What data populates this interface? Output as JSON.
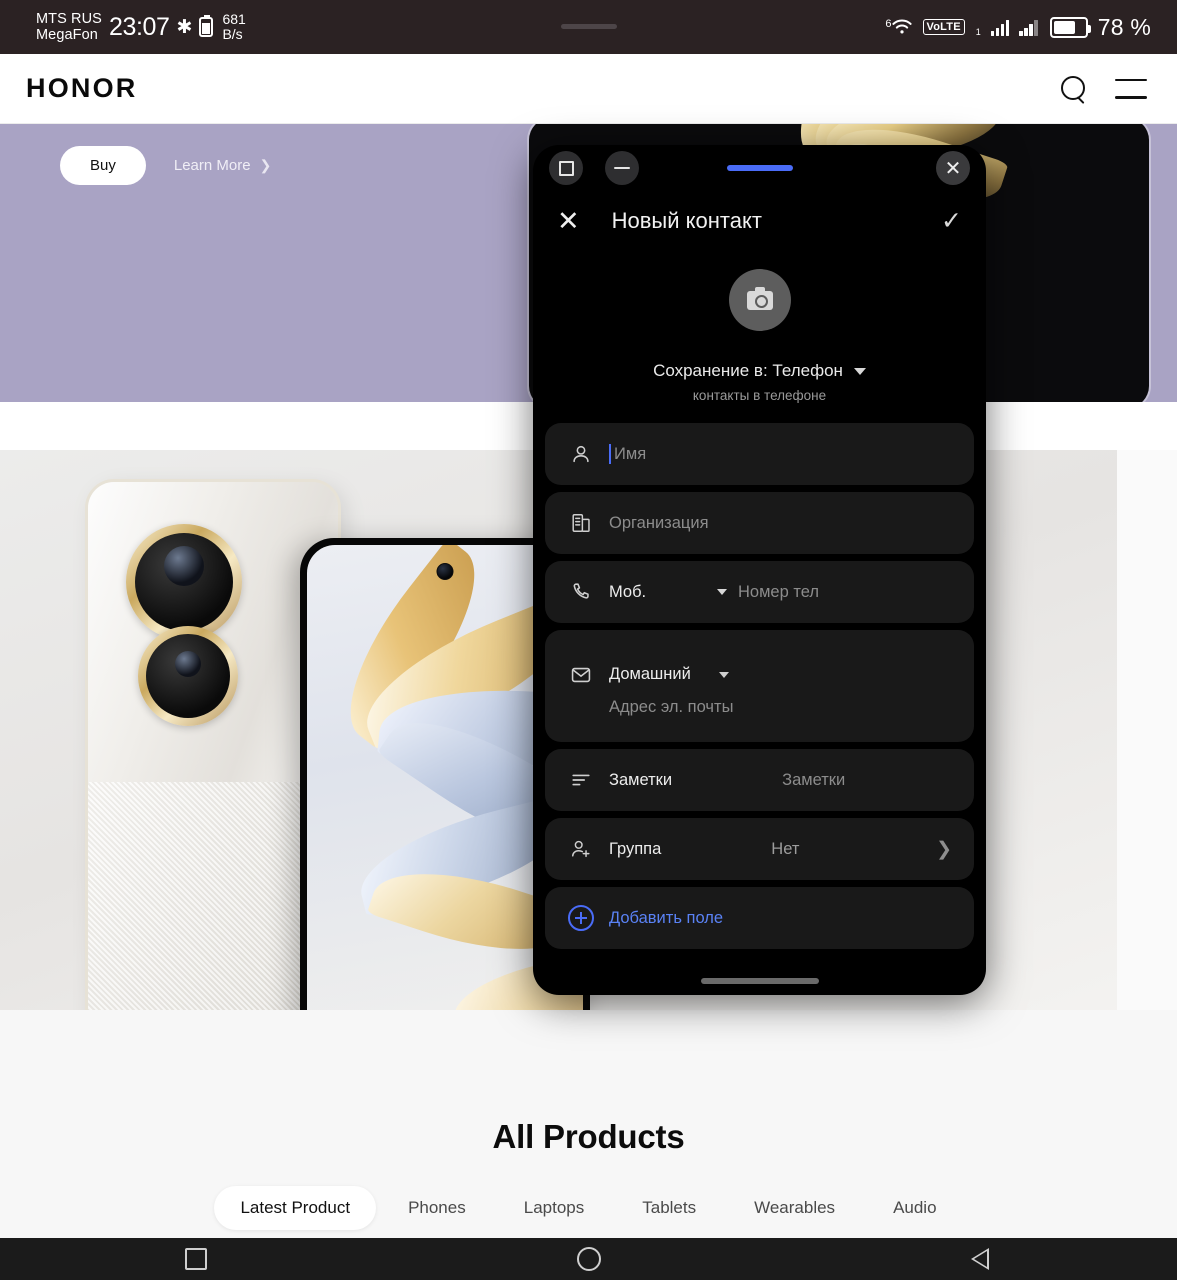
{
  "status_bar": {
    "carrier_line1": "MTS RUS",
    "carrier_line2": "MegaFon",
    "clock": "23:07",
    "bluetooth_icon": "bluetooth-icon",
    "data_speed_value": "681",
    "data_speed_unit": "B/s",
    "wifi_generation": "6",
    "wifi_icon": "wifi-icon",
    "volte_label": "VoLTE",
    "volte_sim": "1",
    "signal_icon_1": "signal-bars-icon",
    "signal_icon_2": "signal-bars-icon",
    "battery_icon": "battery-icon",
    "battery_percent": "78 %"
  },
  "site_header": {
    "logo": "HONOR",
    "search_icon": "search-icon",
    "menu_icon": "hamburger-menu-icon"
  },
  "hero": {
    "buy_label": "Buy",
    "learn_more_label": "Learn More",
    "learn_more_chevron": "chevron-right-icon",
    "background_color": "#a9a3c4"
  },
  "all_products": {
    "title": "All Products",
    "tabs": [
      {
        "label": "Latest Product",
        "active": true
      },
      {
        "label": "Phones",
        "active": false
      },
      {
        "label": "Laptops",
        "active": false
      },
      {
        "label": "Tablets",
        "active": false
      },
      {
        "label": "Wearables",
        "active": false
      },
      {
        "label": "Audio",
        "active": false
      }
    ]
  },
  "floating_window": {
    "maximize_icon": "maximize-square-icon",
    "minimize_icon": "minimize-dash-icon",
    "drag_handle": "window-drag-handle",
    "drag_handle_color": "#4a6cf7",
    "close_icon": "close-x-icon",
    "app_bar": {
      "cancel_icon": "close-x-icon",
      "title": "Новый контакт",
      "confirm_icon": "check-icon"
    },
    "avatar": {
      "icon": "camera-icon"
    },
    "save_to": {
      "label": "Сохранение в: Телефон",
      "dropdown_icon": "chevron-down-icon",
      "subtitle": "контакты в телефоне"
    },
    "fields": [
      {
        "name": "name",
        "icon": "person-icon",
        "placeholder": "Имя",
        "has_caret": true
      },
      {
        "name": "organization",
        "icon": "organization-icon",
        "placeholder": "Организация"
      },
      {
        "name": "phone",
        "icon": "phone-icon",
        "label": "Моб.",
        "dropdown_icon": "caret-down-icon",
        "placeholder": "Номер тел"
      },
      {
        "name": "email",
        "icon": "mail-icon",
        "label": "Домашний",
        "dropdown_icon": "caret-down-icon",
        "placeholder": "Адрес эл. почты"
      },
      {
        "name": "notes",
        "icon": "notes-lines-icon",
        "label": "Заметки",
        "placeholder": "Заметки"
      },
      {
        "name": "group",
        "icon": "add-person-group-icon",
        "label": "Группа",
        "value": "Нет",
        "chevron_icon": "chevron-right-icon"
      }
    ],
    "add_field": {
      "icon": "plus-circle-icon",
      "label": "Добавить поле",
      "color": "#5a82f5"
    },
    "gesture_bar": "window-resize-handle"
  },
  "android_nav": {
    "recents_icon": "square-recents-icon",
    "home_icon": "circle-home-icon",
    "back_icon": "triangle-back-icon"
  }
}
